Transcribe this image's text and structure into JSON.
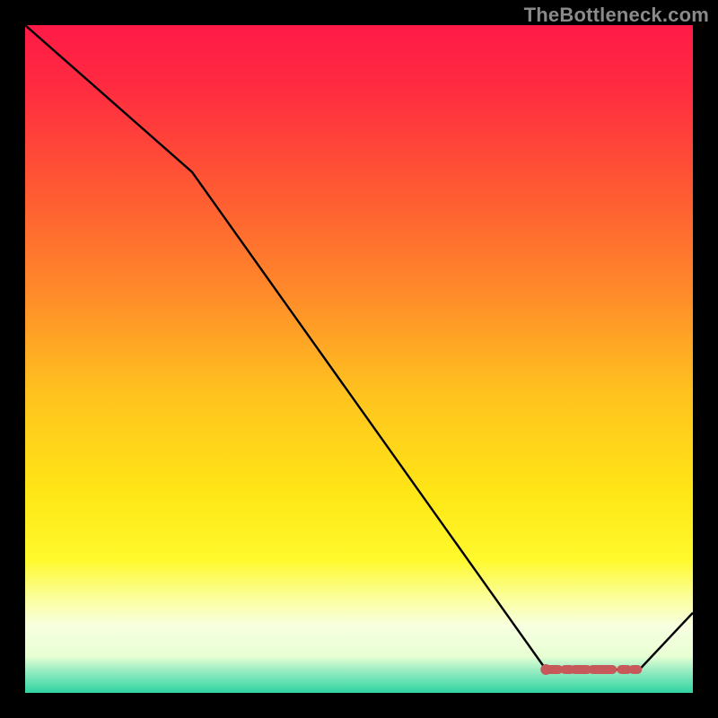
{
  "watermark": "TheBottleneck.com",
  "colors": {
    "background": "#000000",
    "line": "#000000",
    "flat_segment": "#c65a5b",
    "gradient_stops": [
      {
        "offset": 0.0,
        "color": "#ff1a47"
      },
      {
        "offset": 0.1,
        "color": "#ff2d40"
      },
      {
        "offset": 0.25,
        "color": "#ff5a33"
      },
      {
        "offset": 0.4,
        "color": "#ff8a2a"
      },
      {
        "offset": 0.55,
        "color": "#ffc21f"
      },
      {
        "offset": 0.7,
        "color": "#ffe616"
      },
      {
        "offset": 0.8,
        "color": "#fff92c"
      },
      {
        "offset": 0.86,
        "color": "#fbffa0"
      },
      {
        "offset": 0.9,
        "color": "#f7ffe0"
      },
      {
        "offset": 0.945,
        "color": "#e8ffd4"
      },
      {
        "offset": 0.97,
        "color": "#8eeac0"
      },
      {
        "offset": 1.0,
        "color": "#2fd3a0"
      }
    ]
  },
  "chart_data": {
    "type": "line",
    "title": "",
    "xlabel": "",
    "ylabel": "",
    "xlim": [
      0,
      100
    ],
    "ylim": [
      0,
      100
    ],
    "x": [
      0,
      25,
      78,
      92,
      100
    ],
    "values": [
      100,
      78,
      3.5,
      3.5,
      12
    ],
    "flat_segment": {
      "x0": 78,
      "x1": 92,
      "y": 3.5
    }
  }
}
